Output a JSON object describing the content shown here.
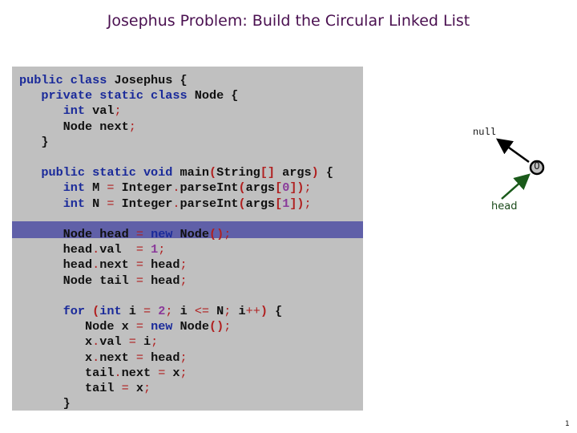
{
  "slide": {
    "title": "Josephus Problem:  Build the Circular Linked List",
    "page_number": "1"
  },
  "code": {
    "highlighted_line_index": 8,
    "lines": [
      [
        [
          "kw",
          "public class"
        ],
        [
          "t",
          " Josephus {"
        ]
      ],
      [
        [
          "t",
          "   "
        ],
        [
          "kw",
          "private static class"
        ],
        [
          "t",
          " Node {"
        ]
      ],
      [
        [
          "t",
          "      "
        ],
        [
          "kw",
          "int"
        ],
        [
          "t",
          " val"
        ],
        [
          "op",
          ";"
        ]
      ],
      [
        [
          "t",
          "      Node next"
        ],
        [
          "op",
          ";"
        ]
      ],
      [
        [
          "t",
          "   }"
        ]
      ],
      [
        [
          "t",
          ""
        ]
      ],
      [
        [
          "t",
          "   "
        ],
        [
          "kw",
          "public static void"
        ],
        [
          "t",
          " main"
        ],
        [
          "p",
          "("
        ],
        [
          "t",
          "String"
        ],
        [
          "p",
          "[]"
        ],
        [
          "t",
          " args"
        ],
        [
          "p",
          ")"
        ],
        [
          "t",
          " {"
        ]
      ],
      [
        [
          "t",
          "      "
        ],
        [
          "kw",
          "int"
        ],
        [
          "t",
          " M "
        ],
        [
          "op",
          "="
        ],
        [
          "t",
          " Integer"
        ],
        [
          "op",
          "."
        ],
        [
          "t",
          "parseInt"
        ],
        [
          "p",
          "("
        ],
        [
          "t",
          "args"
        ],
        [
          "p",
          "["
        ],
        [
          "num",
          "0"
        ],
        [
          "p",
          "])"
        ],
        [
          "op",
          ";"
        ]
      ],
      [
        [
          "t",
          "      "
        ],
        [
          "kw",
          "int"
        ],
        [
          "t",
          " N "
        ],
        [
          "op",
          "="
        ],
        [
          "t",
          " Integer"
        ],
        [
          "op",
          "."
        ],
        [
          "t",
          "parseInt"
        ],
        [
          "p",
          "("
        ],
        [
          "t",
          "args"
        ],
        [
          "p",
          "["
        ],
        [
          "num",
          "1"
        ],
        [
          "p",
          "])"
        ],
        [
          "op",
          ";"
        ]
      ],
      [
        [
          "t",
          ""
        ]
      ],
      [
        [
          "t",
          "      Node head "
        ],
        [
          "op",
          "="
        ],
        [
          "t",
          " "
        ],
        [
          "kw",
          "new"
        ],
        [
          "t",
          " Node"
        ],
        [
          "p",
          "()"
        ],
        [
          "op",
          ";"
        ]
      ],
      [
        [
          "t",
          "      head"
        ],
        [
          "op",
          "."
        ],
        [
          "t",
          "val  "
        ],
        [
          "op",
          "="
        ],
        [
          "t",
          " "
        ],
        [
          "num",
          "1"
        ],
        [
          "op",
          ";"
        ]
      ],
      [
        [
          "t",
          "      head"
        ],
        [
          "op",
          "."
        ],
        [
          "t",
          "next "
        ],
        [
          "op",
          "="
        ],
        [
          "t",
          " head"
        ],
        [
          "op",
          ";"
        ]
      ],
      [
        [
          "t",
          "      Node tail "
        ],
        [
          "op",
          "="
        ],
        [
          "t",
          " head"
        ],
        [
          "op",
          ";"
        ]
      ],
      [
        [
          "t",
          ""
        ]
      ],
      [
        [
          "t",
          "      "
        ],
        [
          "kw",
          "for"
        ],
        [
          "t",
          " "
        ],
        [
          "p",
          "("
        ],
        [
          "kw",
          "int"
        ],
        [
          "t",
          " i "
        ],
        [
          "op",
          "="
        ],
        [
          "t",
          " "
        ],
        [
          "num",
          "2"
        ],
        [
          "op",
          ";"
        ],
        [
          "t",
          " i "
        ],
        [
          "op",
          "<="
        ],
        [
          "t",
          " N"
        ],
        [
          "op",
          ";"
        ],
        [
          "t",
          " i"
        ],
        [
          "op",
          "++"
        ],
        [
          "p",
          ")"
        ],
        [
          "t",
          " {"
        ]
      ],
      [
        [
          "t",
          "         Node x "
        ],
        [
          "op",
          "="
        ],
        [
          "t",
          " "
        ],
        [
          "kw",
          "new"
        ],
        [
          "t",
          " Node"
        ],
        [
          "p",
          "()"
        ],
        [
          "op",
          ";"
        ]
      ],
      [
        [
          "t",
          "         x"
        ],
        [
          "op",
          "."
        ],
        [
          "t",
          "val "
        ],
        [
          "op",
          "="
        ],
        [
          "t",
          " i"
        ],
        [
          "op",
          ";"
        ]
      ],
      [
        [
          "t",
          "         x"
        ],
        [
          "op",
          "."
        ],
        [
          "t",
          "next "
        ],
        [
          "op",
          "="
        ],
        [
          "t",
          " head"
        ],
        [
          "op",
          ";"
        ]
      ],
      [
        [
          "t",
          "         tail"
        ],
        [
          "op",
          "."
        ],
        [
          "t",
          "next "
        ],
        [
          "op",
          "="
        ],
        [
          "t",
          " x"
        ],
        [
          "op",
          ";"
        ]
      ],
      [
        [
          "t",
          "         tail "
        ],
        [
          "op",
          "="
        ],
        [
          "t",
          " x"
        ],
        [
          "op",
          ";"
        ]
      ],
      [
        [
          "t",
          "      }"
        ]
      ]
    ]
  },
  "diagram": {
    "null_label": "null",
    "node_value": "0",
    "head_label": "head",
    "colors": {
      "node_fill": "#c0c0c0",
      "pointer_arrow": "#000000",
      "head_arrow": "#1a5a1a"
    }
  }
}
